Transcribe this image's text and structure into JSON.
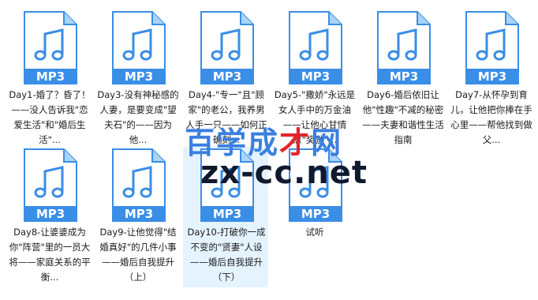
{
  "files": [
    {
      "badge": "MP3",
      "name": "Day1-婚了？昏了！——没人告诉我\"恋爱生活\"和\"婚后生活\"..."
    },
    {
      "badge": "MP3",
      "name": "Day3-没有神秘感的人妻，是要变成\"望夫石\"的——因为他..."
    },
    {
      "badge": "MP3",
      "name": "Day4-\"专一\"且\"顾家\"的老公，我养男人手一只——如何正确刻..."
    },
    {
      "badge": "MP3",
      "name": "Day5-\"撒娇\"永远是女人手中的万金油——让他心甘情愿\"奖励\"..."
    },
    {
      "badge": "MP3",
      "name": "Day6-婚后依旧让他\"性趣\"不减的秘密——夫妻和谐性生活指南"
    },
    {
      "badge": "MP3",
      "name": "Day7-从怀孕到育儿，让他把你捧在手心里——帮他找到做父..."
    },
    {
      "badge": "MP3",
      "name": "Day8-让婆婆成为你\"阵营\"里的一员大将——家庭关系的平衡..."
    },
    {
      "badge": "MP3",
      "name": "Day9-让他觉得\"结婚真好\"的几件小事——婚后自我提升（上）"
    },
    {
      "badge": "MP3",
      "name": "Day10-打破你一成不变的\"贤妻\"人设——婚后自我提升（下）"
    },
    {
      "badge": "MP3",
      "name": "试听"
    }
  ],
  "watermark": {
    "line1_part1": "百",
    "line1_part2": "学",
    "line1_part3": "成",
    "line1_part4": "才",
    "line1_part5": "网",
    "line2": "zx-cc.net"
  },
  "colors": {
    "icon_blue": "#3a8ee6",
    "icon_light": "#a9d3f7",
    "selection": "#e5f3ff"
  }
}
